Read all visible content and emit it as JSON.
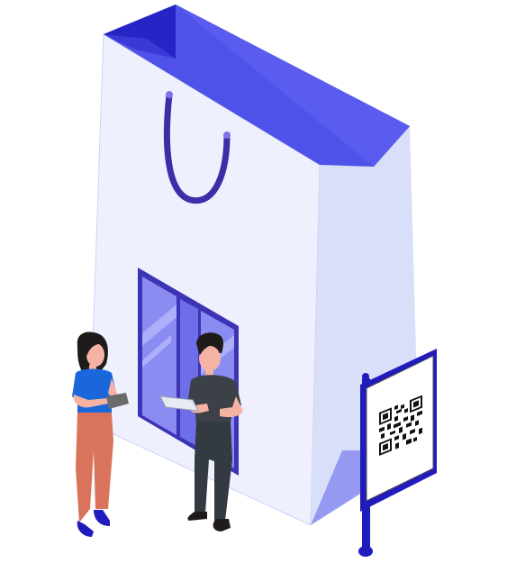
{
  "illustration": {
    "subject": "",
    "colors": {
      "bag_front": "#eef0fd",
      "bag_side": "#dadff9",
      "bag_top": "#4f52e8",
      "bag_top_dark": "#2624c4",
      "handle": "#3b2fa8",
      "door_frame": "#3c33b5",
      "door_glass": "#8b8cf2",
      "sign_pole": "#1f1bbd",
      "sign_panel": "#ffffff",
      "qr": "#111111",
      "woman_shirt": "#1a67dc",
      "woman_pants": "#d9735b",
      "woman_hair": "#1f1b1b",
      "man_shirt": "#3c4147",
      "man_pants": "#333a42",
      "man_hair": "#1f1b1b",
      "skin": "#f5b3a4"
    }
  }
}
